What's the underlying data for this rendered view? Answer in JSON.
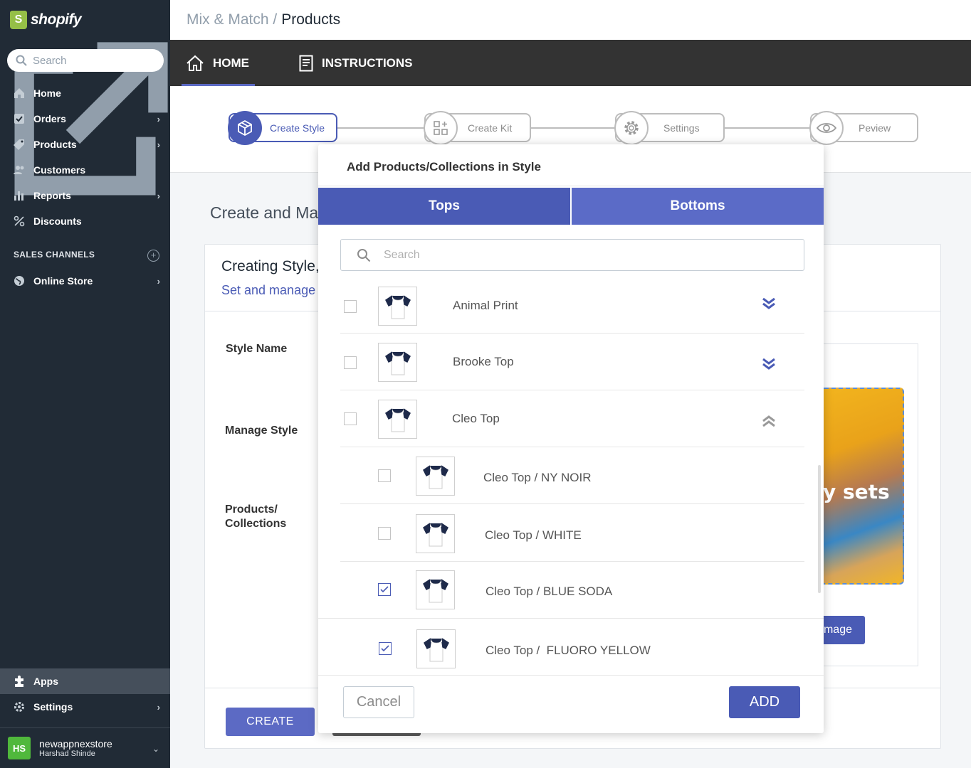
{
  "brand": {
    "name": "shopify",
    "logo_letter": "S"
  },
  "sidebar": {
    "search_placeholder": "Search",
    "items": [
      {
        "label": "Home",
        "icon": "home-icon",
        "has_chevron": false
      },
      {
        "label": "Orders",
        "icon": "orders-icon",
        "has_chevron": true
      },
      {
        "label": "Products",
        "icon": "tag-icon",
        "has_chevron": true
      },
      {
        "label": "Customers",
        "icon": "customers-icon",
        "has_chevron": false
      },
      {
        "label": "Reports",
        "icon": "bar-chart-icon",
        "has_chevron": true
      },
      {
        "label": "Discounts",
        "icon": "discount-icon",
        "has_chevron": false
      }
    ],
    "sales_channels_heading": "SALES CHANNELS",
    "online_store": "Online Store",
    "apps": "Apps",
    "settings": "Settings",
    "store_name": "newappnexstore",
    "store_user": "Harshad Shinde",
    "avatar_initials": "HS"
  },
  "topbar": {
    "crumb_parent": "Mix & Match /",
    "crumb_current": "Products"
  },
  "appnav": {
    "home": "HOME",
    "instructions": "INSTRUCTIONS"
  },
  "steps": [
    "Create Style",
    "Create Kit",
    "Settings",
    "Peview"
  ],
  "page": {
    "title": "Create and Ma",
    "card_title": "Creating Style,",
    "card_subtitle": "Set and manage",
    "label_style_name": "Style Name",
    "label_manage_style": "Manage Style",
    "label_products": "Products/",
    "label_collections": "Collections",
    "preview_text": "y sets",
    "image_button": "mage",
    "create_button": "CREATE"
  },
  "modal": {
    "title": "Add Products/Collections in Style",
    "tab_tops": "Tops",
    "tab_bottoms": "Bottoms",
    "search_placeholder": "Search",
    "rows": [
      {
        "name": "Animal Print",
        "checked": false,
        "level": 0,
        "toggle": "expand"
      },
      {
        "name": "Brooke Top",
        "checked": false,
        "level": 0,
        "toggle": "expand"
      },
      {
        "name": "Cleo Top",
        "checked": false,
        "level": 0,
        "toggle": "collapse"
      },
      {
        "name": "Cleo Top / NY NOIR",
        "checked": false,
        "level": 1,
        "toggle": ""
      },
      {
        "name": "Cleo Top / WHITE",
        "checked": false,
        "level": 1,
        "toggle": ""
      },
      {
        "name": "Cleo Top / BLUE SODA",
        "checked": true,
        "level": 1,
        "toggle": ""
      },
      {
        "name": "Cleo Top /  FLUORO YELLOW",
        "checked": true,
        "level": 1,
        "toggle": ""
      }
    ],
    "cancel": "Cancel",
    "add": "ADD"
  },
  "colors": {
    "accent": "#4a5bb5",
    "sidebar_bg": "#212b36",
    "appnav_bg": "#333333"
  }
}
